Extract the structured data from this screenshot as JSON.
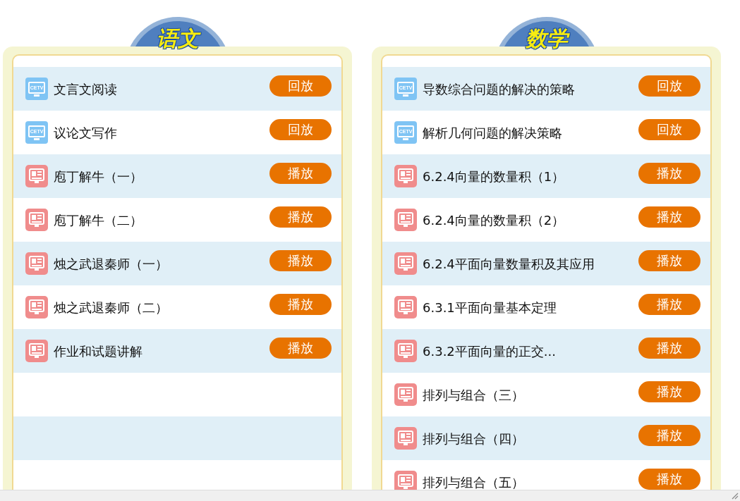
{
  "panels": [
    {
      "title": "语文",
      "items": [
        {
          "kind": "replay",
          "icon_text": "CETV",
          "label": "文言文阅读",
          "action": "回放"
        },
        {
          "kind": "replay",
          "icon_text": "CETV",
          "label": "议论文写作",
          "action": "回放"
        },
        {
          "kind": "play",
          "label": "庖丁解牛（一）",
          "action": "播放"
        },
        {
          "kind": "play",
          "label": "庖丁解牛（二）",
          "action": "播放"
        },
        {
          "kind": "play",
          "label": "烛之武退秦师（一）",
          "action": "播放"
        },
        {
          "kind": "play",
          "label": "烛之武退秦师（二）",
          "action": "播放"
        },
        {
          "kind": "play",
          "label": "作业和试题讲解",
          "action": "播放"
        }
      ]
    },
    {
      "title": "数学",
      "items": [
        {
          "kind": "replay",
          "icon_text": "CETV",
          "label": "导数综合问题的解决的策略",
          "action": "回放"
        },
        {
          "kind": "replay",
          "icon_text": "CETV",
          "label": "解析几何问题的解决策略",
          "action": "回放"
        },
        {
          "kind": "play",
          "label": "6.2.4向量的数量积（1）",
          "action": "播放"
        },
        {
          "kind": "play",
          "label": "6.2.4向量的数量积（2）",
          "action": "播放"
        },
        {
          "kind": "play",
          "label": "6.2.4平面向量数量积及其应用",
          "action": "播放"
        },
        {
          "kind": "play",
          "label": "6.3.1平面向量基本定理",
          "action": "播放"
        },
        {
          "kind": "play",
          "label": "6.3.2平面向量的正交...",
          "action": "播放"
        },
        {
          "kind": "play",
          "label": "排列与组合（三）",
          "action": "播放"
        },
        {
          "kind": "play",
          "label": "排列与组合（四）",
          "action": "播放"
        },
        {
          "kind": "play",
          "label": "排列与组合（五）",
          "action": "播放"
        }
      ]
    }
  ]
}
